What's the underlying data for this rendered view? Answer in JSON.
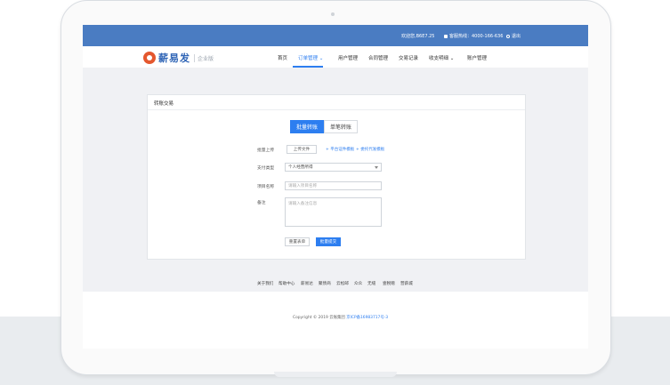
{
  "topbar": {
    "welcome": "欢迎您,B6E7.25",
    "hotline": "客服热线：4000-166-636",
    "logout": "退出"
  },
  "brand": {
    "name": "薪易发",
    "sub": "企业版"
  },
  "nav": {
    "items": [
      {
        "label": "首页"
      },
      {
        "label": "订单管理 ⌄"
      },
      {
        "label": "用户管理"
      },
      {
        "label": "合同管理"
      },
      {
        "label": "交易记录"
      },
      {
        "label": "收支明细 ⌄"
      },
      {
        "label": "账户管理"
      }
    ],
    "active_index": 1
  },
  "panel": {
    "title": "转账交易",
    "tabs": [
      {
        "label": "批量转账"
      },
      {
        "label": "单笔转账"
      }
    ],
    "active_tab": 0,
    "upload_label": "批量上传",
    "upload_button": "上传文件",
    "template_link_1": "+ 平台证件模板",
    "template_link_2": "+ 委托代发模板",
    "type_label": "支付类型",
    "type_value": "个人经营所得",
    "project_label": "项目名称",
    "project_placeholder": "请输入项目名称",
    "remark_label": "备注",
    "remark_placeholder": "请输入备注信息",
    "reset_button": "重置表单",
    "submit_button": "批量提交"
  },
  "footer": {
    "links": [
      {
        "label": "关于我们"
      },
      {
        "label": "帮助中心"
      },
      {
        "label": "薪易达"
      },
      {
        "label": "聚债商"
      },
      {
        "label": "云松邮"
      },
      {
        "label": "众众"
      },
      {
        "label": "无缝"
      },
      {
        "label": "壹税赠"
      },
      {
        "label": "营薪城"
      }
    ],
    "copyright": "Copyright © 2019 云账集团",
    "icp": "京ICP备16983717号-3"
  },
  "colors": {
    "primary": "#2d7ef0",
    "topbar": "#4a7cc2",
    "brand": "#2d63b5",
    "logo": "#e4572e"
  }
}
